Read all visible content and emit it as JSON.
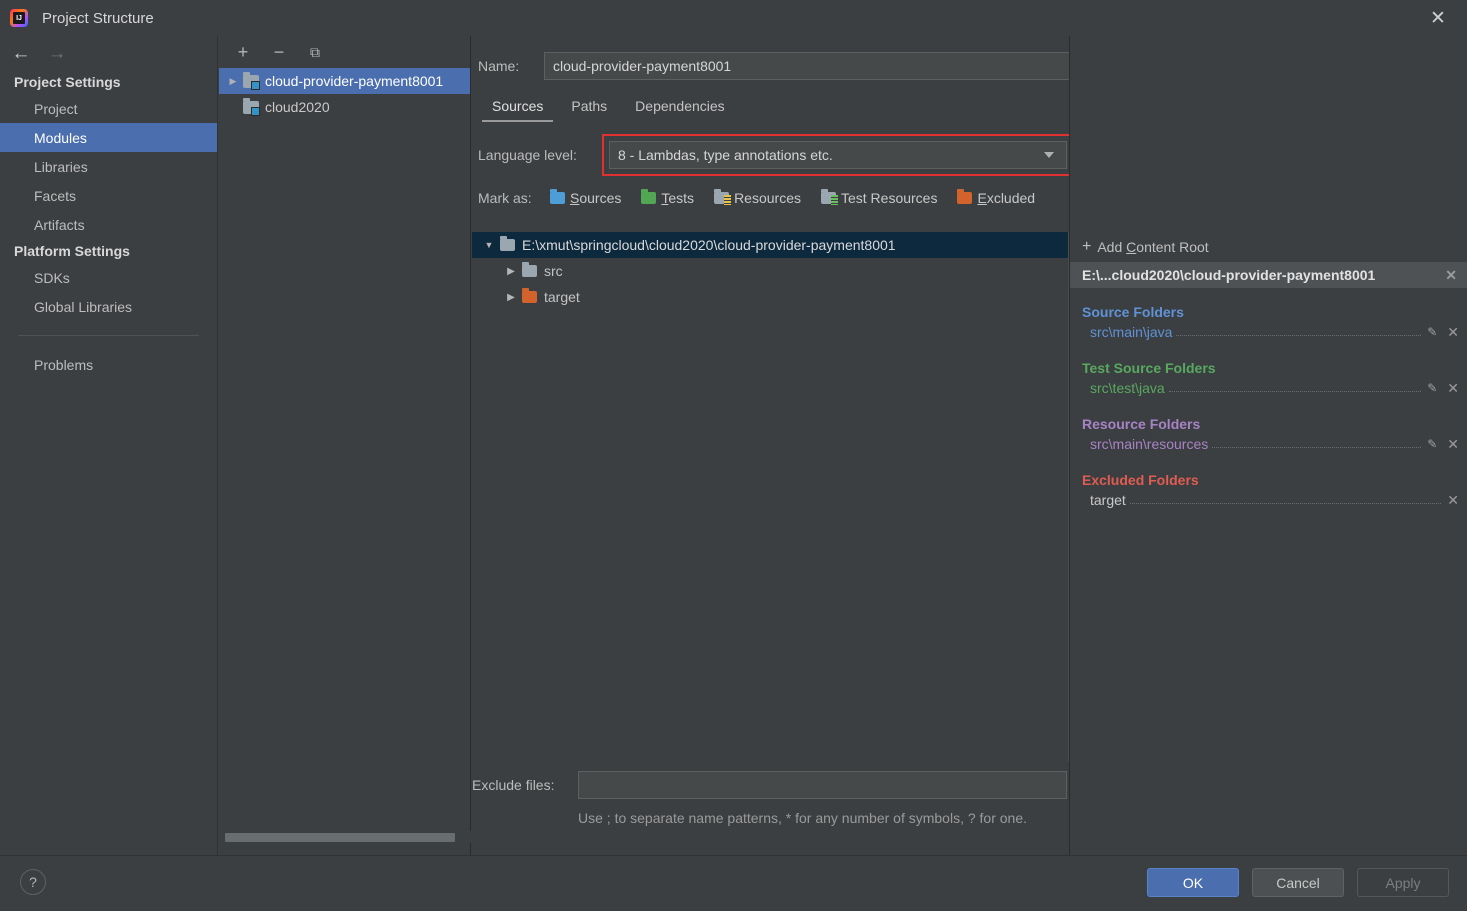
{
  "window": {
    "title": "Project Structure",
    "app_icon": "intellij-idea-icon",
    "close_icon": "close-icon"
  },
  "sidebar": {
    "back_icon": "arrow-left-icon",
    "forward_icon": "arrow-right-icon",
    "groups": [
      {
        "title": "Project Settings",
        "items": [
          {
            "label": "Project",
            "selected": false
          },
          {
            "label": "Modules",
            "selected": true
          },
          {
            "label": "Libraries",
            "selected": false
          },
          {
            "label": "Facets",
            "selected": false
          },
          {
            "label": "Artifacts",
            "selected": false
          }
        ]
      },
      {
        "title": "Platform Settings",
        "items": [
          {
            "label": "SDKs",
            "selected": false
          },
          {
            "label": "Global Libraries",
            "selected": false
          }
        ]
      }
    ],
    "problems_label": "Problems"
  },
  "modules_panel": {
    "toolbar": {
      "add_label": "+",
      "remove_label": "−",
      "copy_label": "⧉"
    },
    "modules": [
      {
        "label": "cloud-provider-payment8001",
        "selected": true,
        "expandable": true
      },
      {
        "label": "cloud2020",
        "selected": false,
        "expandable": false
      }
    ]
  },
  "main": {
    "name_label": "Name:",
    "name_value": "cloud-provider-payment8001",
    "tabs": [
      {
        "label": "Sources",
        "active": true
      },
      {
        "label": "Paths",
        "active": false
      },
      {
        "label": "Dependencies",
        "active": false
      }
    ],
    "language_level_label": "Language level:",
    "language_level_value": "8 - Lambdas, type annotations etc.",
    "language_level_highlight_color": "#e03030",
    "mark_as_label": "Mark as:",
    "mark_as_options": [
      {
        "label": "Sources",
        "mnemonic": "S",
        "rest": "ources",
        "color": "#4d9ed6",
        "icon": "folder-sources-icon"
      },
      {
        "label": "Tests",
        "mnemonic": "T",
        "rest": "ests",
        "color": "#53a653",
        "icon": "folder-tests-icon"
      },
      {
        "label": "Resources",
        "mnemonic": "",
        "rest": "Resources",
        "color": "#9aa7b0",
        "icon": "folder-resources-icon"
      },
      {
        "label": "Test Resources",
        "mnemonic": "",
        "rest": "Test Resources",
        "color": "#9aa7b0",
        "icon": "folder-test-resources-icon"
      },
      {
        "label": "Excluded",
        "mnemonic": "E",
        "rest": "xcluded",
        "color": "#d4622c",
        "icon": "folder-excluded-icon"
      }
    ],
    "tree": [
      {
        "label": "E:\\xmut\\springcloud\\cloud2020\\cloud-provider-payment8001",
        "indent": 0,
        "expanded": true,
        "selected": true,
        "folder": "gray"
      },
      {
        "label": "src",
        "indent": 1,
        "expanded": false,
        "selected": false,
        "folder": "gray"
      },
      {
        "label": "target",
        "indent": 1,
        "expanded": false,
        "selected": false,
        "folder": "orange"
      }
    ],
    "exclude_files_label": "Exclude files:",
    "exclude_files_value": "",
    "exclude_hint": "Use ; to separate name patterns, * for any number of symbols, ? for one."
  },
  "detail": {
    "add_content_root_label": "Add Content Root",
    "add_icon": "plus-icon",
    "content_root_path": "E:\\...cloud2020\\cloud-provider-payment8001",
    "groups": [
      {
        "title": "Source Folders",
        "color": "#5f92d6",
        "kind": "src",
        "rows": [
          {
            "path": "src\\main\\java",
            "has_edit": true,
            "has_remove": true
          }
        ]
      },
      {
        "title": "Test Source Folders",
        "color": "#58a860",
        "kind": "test",
        "rows": [
          {
            "path": "src\\test\\java",
            "has_edit": true,
            "has_remove": true
          }
        ]
      },
      {
        "title": "Resource Folders",
        "color": "#a783c6",
        "kind": "res",
        "rows": [
          {
            "path": "src\\main\\resources",
            "has_edit": true,
            "has_remove": true
          }
        ]
      },
      {
        "title": "Excluded Folders",
        "color": "#e05c52",
        "kind": "exc",
        "rows": [
          {
            "path": "target",
            "has_edit": false,
            "has_remove": true
          }
        ]
      }
    ]
  },
  "footer": {
    "help_label": "?",
    "ok_label": "OK",
    "cancel_label": "Cancel",
    "apply_label": "Apply"
  }
}
